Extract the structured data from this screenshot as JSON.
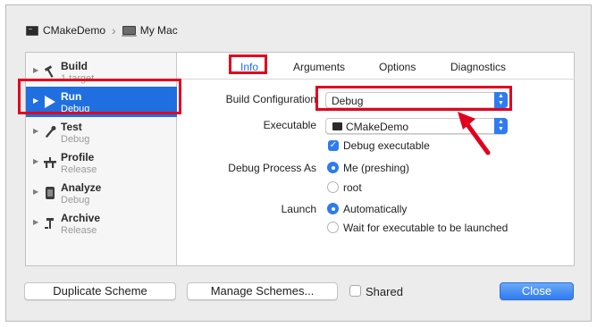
{
  "breadcrumb": {
    "scheme": "CMakeDemo",
    "destination": "My Mac"
  },
  "sidebar": {
    "items": [
      {
        "title": "Build",
        "subtitle": "1 target",
        "icon": "hammer-icon"
      },
      {
        "title": "Run",
        "subtitle": "Debug",
        "icon": "play-icon",
        "selected": true
      },
      {
        "title": "Test",
        "subtitle": "Debug",
        "icon": "wrench-icon"
      },
      {
        "title": "Profile",
        "subtitle": "Release",
        "icon": "caliper-icon"
      },
      {
        "title": "Analyze",
        "subtitle": "Debug",
        "icon": "analyze-icon"
      },
      {
        "title": "Archive",
        "subtitle": "Release",
        "icon": "archive-icon"
      }
    ]
  },
  "tabs": [
    {
      "label": "Info",
      "active": true
    },
    {
      "label": "Arguments"
    },
    {
      "label": "Options"
    },
    {
      "label": "Diagnostics"
    }
  ],
  "info": {
    "build_configuration_label": "Build Configuration",
    "build_configuration_value": "Debug",
    "executable_label": "Executable",
    "executable_value": "CMakeDemo",
    "debug_executable_label": "Debug executable",
    "debug_process_as_label": "Debug Process As",
    "debug_process_options": [
      "Me (preshing)",
      "root"
    ],
    "launch_label": "Launch",
    "launch_options": [
      "Automatically",
      "Wait for executable to be launched"
    ]
  },
  "footer": {
    "duplicate_label": "Duplicate Scheme",
    "manage_label": "Manage Schemes...",
    "shared_label": "Shared",
    "close_label": "Close"
  },
  "colors": {
    "accent": "#2f7bf0",
    "selection": "#1f6fe0",
    "annotation": "#e1001e"
  }
}
